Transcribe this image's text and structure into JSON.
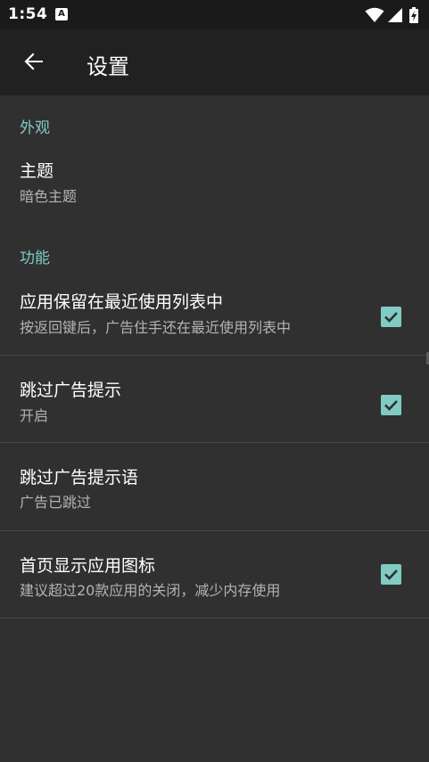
{
  "status_bar": {
    "time": "1:54",
    "notification_icon_label": "A",
    "icons": [
      "wifi-icon",
      "cell-signal-icon",
      "battery-charging-icon"
    ]
  },
  "app_bar": {
    "title": "设置",
    "back_icon": "arrow-back-icon"
  },
  "sections": [
    {
      "header": "外观",
      "items": [
        {
          "title": "主题",
          "summary": "暗色主题"
        }
      ]
    },
    {
      "header": "功能",
      "items": [
        {
          "title": "应用保留在最近使用列表中",
          "summary": "按返回键后，广告住手还在最近使用列表中",
          "checked": true
        },
        {
          "title": "跳过广告提示",
          "summary": "开启",
          "checked": true
        },
        {
          "title": "跳过广告提示语",
          "summary": "广告已跳过"
        },
        {
          "title": "首页显示应用图标",
          "summary": "建议超过20款应用的关闭，减少内存使用",
          "checked": true
        }
      ]
    }
  ],
  "colors": {
    "accent": "#80cbc4",
    "background": "#303030",
    "app_bar": "#212121",
    "status_bar": "#1a1a1a",
    "divider": "#474747",
    "secondary_text": "#b3b3b3"
  }
}
